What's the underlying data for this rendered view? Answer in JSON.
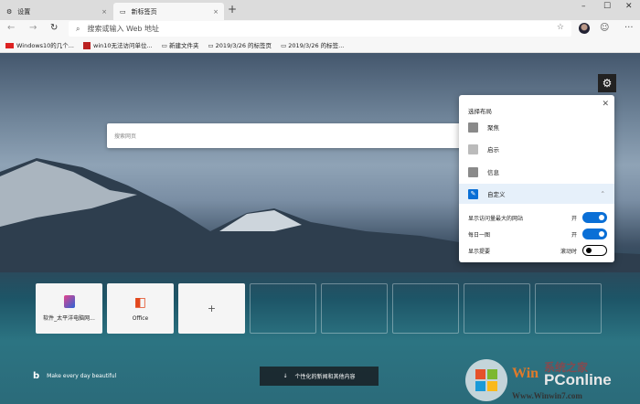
{
  "tabs": [
    {
      "label": "设置",
      "icon": "gear-icon"
    },
    {
      "label": "新标签页",
      "icon": "newtab-icon"
    }
  ],
  "address": {
    "placeholder": "搜索或输入 Web 地址"
  },
  "bookmarks": [
    "Windows10的几个...",
    "win10无法访问单位...",
    "新建文件夹",
    "2019/3/26 的标签页",
    "2019/3/26 的标签..."
  ],
  "search": {
    "placeholder": "搜索网页"
  },
  "panel": {
    "title": "选择布局",
    "options": [
      "聚焦",
      "启示",
      "信息",
      "自定义"
    ],
    "settings": [
      {
        "label": "显示访问量最大的网站",
        "state": "开",
        "on": true
      },
      {
        "label": "每日一图",
        "state": "开",
        "on": true
      },
      {
        "label": "显示提要",
        "state": "滚动时",
        "on": false
      }
    ]
  },
  "tiles": [
    {
      "label": "软件_太平洋电脑网..."
    },
    {
      "label": "Office"
    },
    {
      "label": "+"
    }
  ],
  "bing": {
    "tagline": "Make every day beautiful"
  },
  "news": {
    "label": "个性化的新闻和其他内容"
  },
  "watermark": {
    "text": "Win系统之家 PConline Www.Winwin7.com"
  }
}
